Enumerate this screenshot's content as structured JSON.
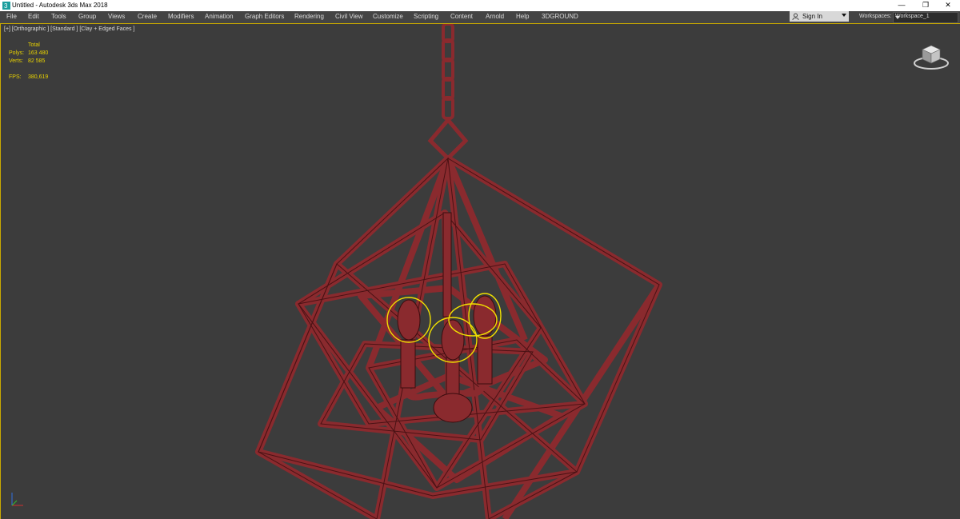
{
  "window": {
    "title": "Untitled - Autodesk 3ds Max 2018",
    "minimize_glyph": "—",
    "restore_glyph": "❐",
    "close_glyph": "✕"
  },
  "menu": {
    "items": [
      "File",
      "Edit",
      "Tools",
      "Group",
      "Views",
      "Create",
      "Modifiers",
      "Animation",
      "Graph Editors",
      "Rendering",
      "Civil View",
      "Customize",
      "Scripting",
      "Content",
      "Arnold",
      "Help",
      "3DGROUND"
    ]
  },
  "account": {
    "sign_in": "Sign In"
  },
  "workspace": {
    "label": "Workspaces:",
    "value": "Workspace_1"
  },
  "viewport": {
    "label": "[+] [Orthographic ] [Standard ] [Clay + Edged Faces ]",
    "stats": {
      "total_label": "Total",
      "polys_label": "Polys:",
      "polys_value": "163 480",
      "verts_label": "Verts:",
      "verts_value": "82 585",
      "fps_label": "FPS:",
      "fps_value": "380,619"
    }
  },
  "colors": {
    "viewport_bg": "#3c3c3c",
    "model_fill": "#8a2a2e",
    "model_edge": "#3a0c0e",
    "selection": "#f0e000",
    "accent": "#c8a800"
  },
  "icons": {
    "app": "3dsmax-app-icon",
    "user": "user-icon",
    "viewcube": "viewcube-icon",
    "axis": "axis-tripod-icon"
  }
}
